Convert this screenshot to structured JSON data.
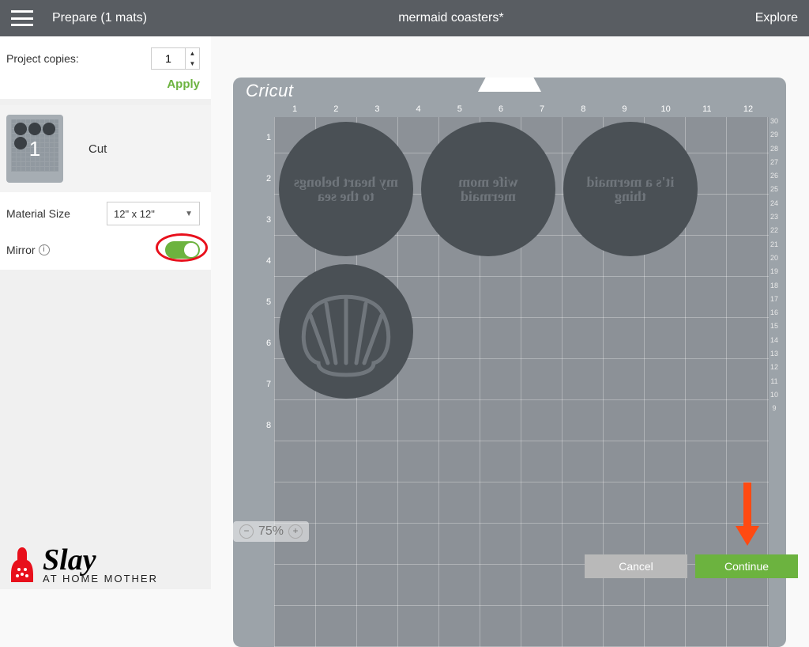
{
  "topbar": {
    "left": "Prepare (1 mats)",
    "center": "mermaid coasters*",
    "right": "Explore"
  },
  "sidebar": {
    "copies_label": "Project copies:",
    "copies_value": "1",
    "apply_label": "Apply",
    "mat_number": "1",
    "mat_mode": "Cut",
    "material_label": "Material Size",
    "material_value": "12\" x 12\"",
    "mirror_label": "Mirror",
    "mirror_on": true
  },
  "mat": {
    "brand": "Cricut",
    "top_ticks": [
      "1",
      "2",
      "3",
      "4",
      "5",
      "6",
      "7",
      "8",
      "9",
      "10",
      "11",
      "12"
    ],
    "left_ticks": [
      "1",
      "2",
      "3",
      "4",
      "5",
      "6",
      "7",
      "8"
    ],
    "right_ticks": [
      "30",
      "29",
      "28",
      "27",
      "26",
      "25",
      "24",
      "23",
      "22",
      "21",
      "20",
      "19",
      "18",
      "17",
      "16",
      "15",
      "14",
      "13",
      "12",
      "11",
      "10",
      "9"
    ]
  },
  "zoom": {
    "value": "75%"
  },
  "footer": {
    "cancel": "Cancel",
    "continue": "Continue"
  },
  "watermark": {
    "line1": "Slay",
    "line2": "AT HOME MOTHER"
  }
}
